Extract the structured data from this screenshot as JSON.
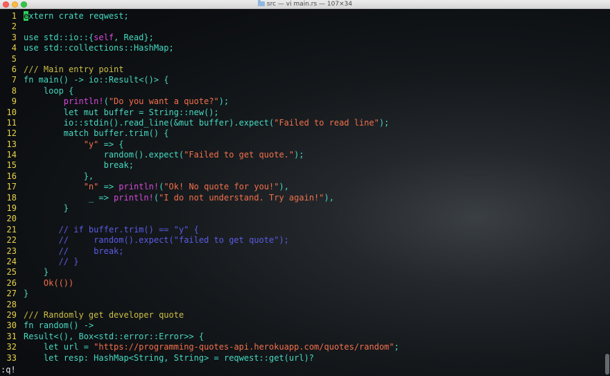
{
  "window": {
    "title": "src — vi main.rs — 107×34",
    "title_icon": "folder-icon"
  },
  "colors": {
    "keyword": "#39c7a8",
    "text": "#46d9c1",
    "macro": "#d44ad6",
    "string": "#f3704c",
    "comment_doc": "#ccbf46",
    "comment": "#5b5be5",
    "default": "#cfcfcf",
    "linenumber": "#e8d44d",
    "cursor": "#2bd05a"
  },
  "editor": {
    "lines": [
      {
        "num": "1",
        "tokens": [
          {
            "t": "e",
            "c": "cursor"
          },
          {
            "t": "xtern crate reqwest;",
            "c": "text"
          }
        ]
      },
      {
        "num": "2",
        "tokens": []
      },
      {
        "num": "3",
        "tokens": [
          {
            "t": "use std::io::{",
            "c": "text"
          },
          {
            "t": "self",
            "c": "macro"
          },
          {
            "t": ", Read};",
            "c": "text"
          }
        ]
      },
      {
        "num": "4",
        "tokens": [
          {
            "t": "use std::collections::HashMap;",
            "c": "text"
          }
        ]
      },
      {
        "num": "5",
        "tokens": []
      },
      {
        "num": "6",
        "tokens": [
          {
            "t": "/// Main entry point",
            "c": "comment_doc"
          }
        ]
      },
      {
        "num": "7",
        "tokens": [
          {
            "t": "fn main() -> io::Result<()> {",
            "c": "text"
          }
        ]
      },
      {
        "num": "8",
        "tokens": [
          {
            "t": "    loop {",
            "c": "text"
          }
        ]
      },
      {
        "num": "9",
        "tokens": [
          {
            "t": "        ",
            "c": "text"
          },
          {
            "t": "println!",
            "c": "macro"
          },
          {
            "t": "(",
            "c": "text"
          },
          {
            "t": "\"Do you want a quote?\"",
            "c": "string"
          },
          {
            "t": ");",
            "c": "text"
          }
        ]
      },
      {
        "num": "10",
        "tokens": [
          {
            "t": "        let mut buffer = String::new();",
            "c": "text"
          }
        ]
      },
      {
        "num": "11",
        "tokens": [
          {
            "t": "        io::stdin().read_line(&mut buffer).expect(",
            "c": "text"
          },
          {
            "t": "\"Failed to read line\"",
            "c": "string"
          },
          {
            "t": ");",
            "c": "text"
          }
        ]
      },
      {
        "num": "12",
        "tokens": [
          {
            "t": "        match buffer.trim() {",
            "c": "text"
          }
        ]
      },
      {
        "num": "13",
        "tokens": [
          {
            "t": "            ",
            "c": "text"
          },
          {
            "t": "\"y\"",
            "c": "string"
          },
          {
            "t": " => {",
            "c": "text"
          }
        ]
      },
      {
        "num": "14",
        "tokens": [
          {
            "t": "                random().expect(",
            "c": "text"
          },
          {
            "t": "\"Failed to get quote.\"",
            "c": "string"
          },
          {
            "t": ");",
            "c": "text"
          }
        ]
      },
      {
        "num": "15",
        "tokens": [
          {
            "t": "                break;",
            "c": "text"
          }
        ]
      },
      {
        "num": "16",
        "tokens": [
          {
            "t": "            },",
            "c": "text"
          }
        ]
      },
      {
        "num": "17",
        "tokens": [
          {
            "t": "            ",
            "c": "text"
          },
          {
            "t": "\"n\"",
            "c": "string"
          },
          {
            "t": " => ",
            "c": "text"
          },
          {
            "t": "println!",
            "c": "macro"
          },
          {
            "t": "(",
            "c": "text"
          },
          {
            "t": "\"Ok! No quote for you!\"",
            "c": "string"
          },
          {
            "t": "),",
            "c": "text"
          }
        ]
      },
      {
        "num": "18",
        "tokens": [
          {
            "t": "             _ => ",
            "c": "text"
          },
          {
            "t": "println!",
            "c": "macro"
          },
          {
            "t": "(",
            "c": "text"
          },
          {
            "t": "\"I do not understand. Try again!\"",
            "c": "string"
          },
          {
            "t": "),",
            "c": "text"
          }
        ]
      },
      {
        "num": "19",
        "tokens": [
          {
            "t": "        }",
            "c": "text"
          }
        ]
      },
      {
        "num": "20",
        "tokens": []
      },
      {
        "num": "21",
        "tokens": [
          {
            "t": "       // if buffer.trim() == \"y\" {",
            "c": "comment"
          }
        ]
      },
      {
        "num": "22",
        "tokens": [
          {
            "t": "       //     random().expect(\"failed to get quote\");",
            "c": "comment"
          }
        ]
      },
      {
        "num": "23",
        "tokens": [
          {
            "t": "       //     break;",
            "c": "comment"
          }
        ]
      },
      {
        "num": "24",
        "tokens": [
          {
            "t": "       // }",
            "c": "comment"
          }
        ]
      },
      {
        "num": "25",
        "tokens": [
          {
            "t": "    }",
            "c": "text"
          }
        ]
      },
      {
        "num": "26",
        "tokens": [
          {
            "t": "    Ok(())",
            "c": "string"
          }
        ]
      },
      {
        "num": "27",
        "tokens": [
          {
            "t": "}",
            "c": "text"
          }
        ]
      },
      {
        "num": "28",
        "tokens": []
      },
      {
        "num": "29",
        "tokens": [
          {
            "t": "/// Randomly get developer quote",
            "c": "comment_doc"
          }
        ]
      },
      {
        "num": "30",
        "tokens": [
          {
            "t": "fn random() ->",
            "c": "text"
          }
        ]
      },
      {
        "num": "31",
        "tokens": [
          {
            "t": "Result<(), Box<std::error::Error>> {",
            "c": "text"
          }
        ]
      },
      {
        "num": "32",
        "tokens": [
          {
            "t": "    let url = ",
            "c": "text"
          },
          {
            "t": "\"https://programming-quotes-api.herokuapp.com/quotes/random\"",
            "c": "string"
          },
          {
            "t": ";",
            "c": "text"
          }
        ]
      },
      {
        "num": "33",
        "tokens": [
          {
            "t": "    let resp: HashMap<String, String> = reqwest::get(url)?",
            "c": "text"
          }
        ]
      }
    ]
  },
  "command_line": ":q!"
}
